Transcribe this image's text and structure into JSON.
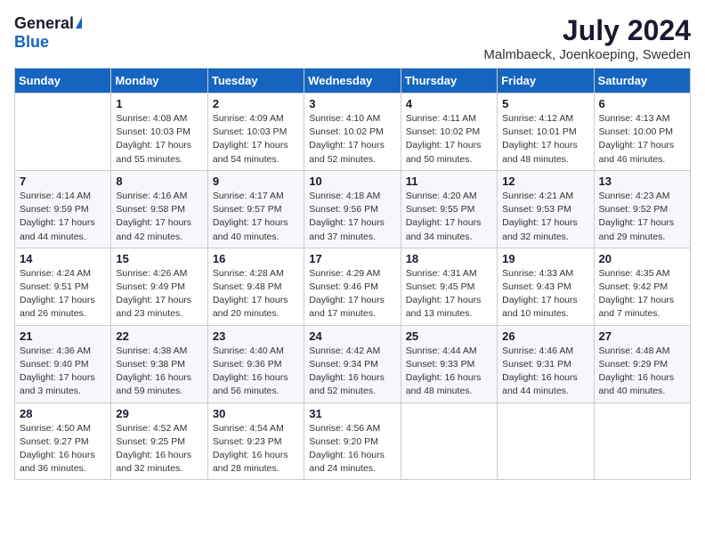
{
  "header": {
    "logo_general": "General",
    "logo_blue": "Blue",
    "month_title": "July 2024",
    "location": "Malmbaeck, Joenkoeping, Sweden"
  },
  "days_of_week": [
    "Sunday",
    "Monday",
    "Tuesday",
    "Wednesday",
    "Thursday",
    "Friday",
    "Saturday"
  ],
  "weeks": [
    [
      {
        "day": "",
        "info": ""
      },
      {
        "day": "1",
        "info": "Sunrise: 4:08 AM\nSunset: 10:03 PM\nDaylight: 17 hours\nand 55 minutes."
      },
      {
        "day": "2",
        "info": "Sunrise: 4:09 AM\nSunset: 10:03 PM\nDaylight: 17 hours\nand 54 minutes."
      },
      {
        "day": "3",
        "info": "Sunrise: 4:10 AM\nSunset: 10:02 PM\nDaylight: 17 hours\nand 52 minutes."
      },
      {
        "day": "4",
        "info": "Sunrise: 4:11 AM\nSunset: 10:02 PM\nDaylight: 17 hours\nand 50 minutes."
      },
      {
        "day": "5",
        "info": "Sunrise: 4:12 AM\nSunset: 10:01 PM\nDaylight: 17 hours\nand 48 minutes."
      },
      {
        "day": "6",
        "info": "Sunrise: 4:13 AM\nSunset: 10:00 PM\nDaylight: 17 hours\nand 46 minutes."
      }
    ],
    [
      {
        "day": "7",
        "info": "Sunrise: 4:14 AM\nSunset: 9:59 PM\nDaylight: 17 hours\nand 44 minutes."
      },
      {
        "day": "8",
        "info": "Sunrise: 4:16 AM\nSunset: 9:58 PM\nDaylight: 17 hours\nand 42 minutes."
      },
      {
        "day": "9",
        "info": "Sunrise: 4:17 AM\nSunset: 9:57 PM\nDaylight: 17 hours\nand 40 minutes."
      },
      {
        "day": "10",
        "info": "Sunrise: 4:18 AM\nSunset: 9:56 PM\nDaylight: 17 hours\nand 37 minutes."
      },
      {
        "day": "11",
        "info": "Sunrise: 4:20 AM\nSunset: 9:55 PM\nDaylight: 17 hours\nand 34 minutes."
      },
      {
        "day": "12",
        "info": "Sunrise: 4:21 AM\nSunset: 9:53 PM\nDaylight: 17 hours\nand 32 minutes."
      },
      {
        "day": "13",
        "info": "Sunrise: 4:23 AM\nSunset: 9:52 PM\nDaylight: 17 hours\nand 29 minutes."
      }
    ],
    [
      {
        "day": "14",
        "info": "Sunrise: 4:24 AM\nSunset: 9:51 PM\nDaylight: 17 hours\nand 26 minutes."
      },
      {
        "day": "15",
        "info": "Sunrise: 4:26 AM\nSunset: 9:49 PM\nDaylight: 17 hours\nand 23 minutes."
      },
      {
        "day": "16",
        "info": "Sunrise: 4:28 AM\nSunset: 9:48 PM\nDaylight: 17 hours\nand 20 minutes."
      },
      {
        "day": "17",
        "info": "Sunrise: 4:29 AM\nSunset: 9:46 PM\nDaylight: 17 hours\nand 17 minutes."
      },
      {
        "day": "18",
        "info": "Sunrise: 4:31 AM\nSunset: 9:45 PM\nDaylight: 17 hours\nand 13 minutes."
      },
      {
        "day": "19",
        "info": "Sunrise: 4:33 AM\nSunset: 9:43 PM\nDaylight: 17 hours\nand 10 minutes."
      },
      {
        "day": "20",
        "info": "Sunrise: 4:35 AM\nSunset: 9:42 PM\nDaylight: 17 hours\nand 7 minutes."
      }
    ],
    [
      {
        "day": "21",
        "info": "Sunrise: 4:36 AM\nSunset: 9:40 PM\nDaylight: 17 hours\nand 3 minutes."
      },
      {
        "day": "22",
        "info": "Sunrise: 4:38 AM\nSunset: 9:38 PM\nDaylight: 16 hours\nand 59 minutes."
      },
      {
        "day": "23",
        "info": "Sunrise: 4:40 AM\nSunset: 9:36 PM\nDaylight: 16 hours\nand 56 minutes."
      },
      {
        "day": "24",
        "info": "Sunrise: 4:42 AM\nSunset: 9:34 PM\nDaylight: 16 hours\nand 52 minutes."
      },
      {
        "day": "25",
        "info": "Sunrise: 4:44 AM\nSunset: 9:33 PM\nDaylight: 16 hours\nand 48 minutes."
      },
      {
        "day": "26",
        "info": "Sunrise: 4:46 AM\nSunset: 9:31 PM\nDaylight: 16 hours\nand 44 minutes."
      },
      {
        "day": "27",
        "info": "Sunrise: 4:48 AM\nSunset: 9:29 PM\nDaylight: 16 hours\nand 40 minutes."
      }
    ],
    [
      {
        "day": "28",
        "info": "Sunrise: 4:50 AM\nSunset: 9:27 PM\nDaylight: 16 hours\nand 36 minutes."
      },
      {
        "day": "29",
        "info": "Sunrise: 4:52 AM\nSunset: 9:25 PM\nDaylight: 16 hours\nand 32 minutes."
      },
      {
        "day": "30",
        "info": "Sunrise: 4:54 AM\nSunset: 9:23 PM\nDaylight: 16 hours\nand 28 minutes."
      },
      {
        "day": "31",
        "info": "Sunrise: 4:56 AM\nSunset: 9:20 PM\nDaylight: 16 hours\nand 24 minutes."
      },
      {
        "day": "",
        "info": ""
      },
      {
        "day": "",
        "info": ""
      },
      {
        "day": "",
        "info": ""
      }
    ]
  ]
}
